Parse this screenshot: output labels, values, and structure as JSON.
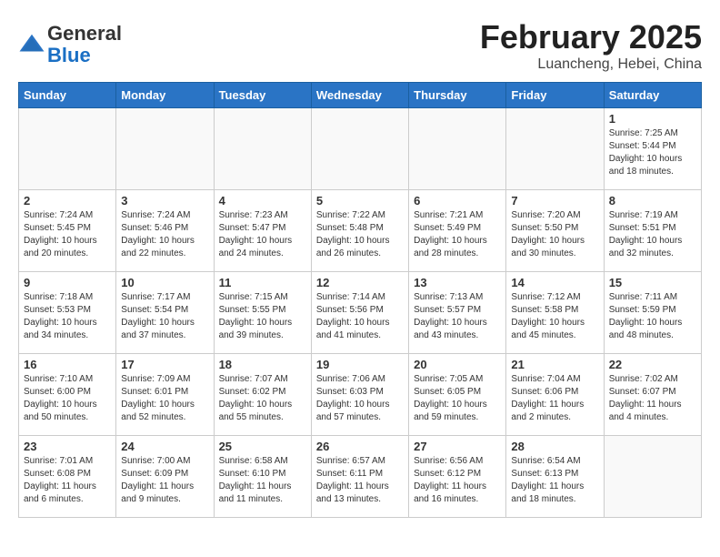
{
  "header": {
    "logo_general": "General",
    "logo_blue": "Blue",
    "month_title": "February 2025",
    "location": "Luancheng, Hebei, China"
  },
  "days_of_week": [
    "Sunday",
    "Monday",
    "Tuesday",
    "Wednesday",
    "Thursday",
    "Friday",
    "Saturday"
  ],
  "weeks": [
    [
      {
        "day": "",
        "info": ""
      },
      {
        "day": "",
        "info": ""
      },
      {
        "day": "",
        "info": ""
      },
      {
        "day": "",
        "info": ""
      },
      {
        "day": "",
        "info": ""
      },
      {
        "day": "",
        "info": ""
      },
      {
        "day": "1",
        "info": "Sunrise: 7:25 AM\nSunset: 5:44 PM\nDaylight: 10 hours\nand 18 minutes."
      }
    ],
    [
      {
        "day": "2",
        "info": "Sunrise: 7:24 AM\nSunset: 5:45 PM\nDaylight: 10 hours\nand 20 minutes."
      },
      {
        "day": "3",
        "info": "Sunrise: 7:24 AM\nSunset: 5:46 PM\nDaylight: 10 hours\nand 22 minutes."
      },
      {
        "day": "4",
        "info": "Sunrise: 7:23 AM\nSunset: 5:47 PM\nDaylight: 10 hours\nand 24 minutes."
      },
      {
        "day": "5",
        "info": "Sunrise: 7:22 AM\nSunset: 5:48 PM\nDaylight: 10 hours\nand 26 minutes."
      },
      {
        "day": "6",
        "info": "Sunrise: 7:21 AM\nSunset: 5:49 PM\nDaylight: 10 hours\nand 28 minutes."
      },
      {
        "day": "7",
        "info": "Sunrise: 7:20 AM\nSunset: 5:50 PM\nDaylight: 10 hours\nand 30 minutes."
      },
      {
        "day": "8",
        "info": "Sunrise: 7:19 AM\nSunset: 5:51 PM\nDaylight: 10 hours\nand 32 minutes."
      }
    ],
    [
      {
        "day": "9",
        "info": "Sunrise: 7:18 AM\nSunset: 5:53 PM\nDaylight: 10 hours\nand 34 minutes."
      },
      {
        "day": "10",
        "info": "Sunrise: 7:17 AM\nSunset: 5:54 PM\nDaylight: 10 hours\nand 37 minutes."
      },
      {
        "day": "11",
        "info": "Sunrise: 7:15 AM\nSunset: 5:55 PM\nDaylight: 10 hours\nand 39 minutes."
      },
      {
        "day": "12",
        "info": "Sunrise: 7:14 AM\nSunset: 5:56 PM\nDaylight: 10 hours\nand 41 minutes."
      },
      {
        "day": "13",
        "info": "Sunrise: 7:13 AM\nSunset: 5:57 PM\nDaylight: 10 hours\nand 43 minutes."
      },
      {
        "day": "14",
        "info": "Sunrise: 7:12 AM\nSunset: 5:58 PM\nDaylight: 10 hours\nand 45 minutes."
      },
      {
        "day": "15",
        "info": "Sunrise: 7:11 AM\nSunset: 5:59 PM\nDaylight: 10 hours\nand 48 minutes."
      }
    ],
    [
      {
        "day": "16",
        "info": "Sunrise: 7:10 AM\nSunset: 6:00 PM\nDaylight: 10 hours\nand 50 minutes."
      },
      {
        "day": "17",
        "info": "Sunrise: 7:09 AM\nSunset: 6:01 PM\nDaylight: 10 hours\nand 52 minutes."
      },
      {
        "day": "18",
        "info": "Sunrise: 7:07 AM\nSunset: 6:02 PM\nDaylight: 10 hours\nand 55 minutes."
      },
      {
        "day": "19",
        "info": "Sunrise: 7:06 AM\nSunset: 6:03 PM\nDaylight: 10 hours\nand 57 minutes."
      },
      {
        "day": "20",
        "info": "Sunrise: 7:05 AM\nSunset: 6:05 PM\nDaylight: 10 hours\nand 59 minutes."
      },
      {
        "day": "21",
        "info": "Sunrise: 7:04 AM\nSunset: 6:06 PM\nDaylight: 11 hours\nand 2 minutes."
      },
      {
        "day": "22",
        "info": "Sunrise: 7:02 AM\nSunset: 6:07 PM\nDaylight: 11 hours\nand 4 minutes."
      }
    ],
    [
      {
        "day": "23",
        "info": "Sunrise: 7:01 AM\nSunset: 6:08 PM\nDaylight: 11 hours\nand 6 minutes."
      },
      {
        "day": "24",
        "info": "Sunrise: 7:00 AM\nSunset: 6:09 PM\nDaylight: 11 hours\nand 9 minutes."
      },
      {
        "day": "25",
        "info": "Sunrise: 6:58 AM\nSunset: 6:10 PM\nDaylight: 11 hours\nand 11 minutes."
      },
      {
        "day": "26",
        "info": "Sunrise: 6:57 AM\nSunset: 6:11 PM\nDaylight: 11 hours\nand 13 minutes."
      },
      {
        "day": "27",
        "info": "Sunrise: 6:56 AM\nSunset: 6:12 PM\nDaylight: 11 hours\nand 16 minutes."
      },
      {
        "day": "28",
        "info": "Sunrise: 6:54 AM\nSunset: 6:13 PM\nDaylight: 11 hours\nand 18 minutes."
      },
      {
        "day": "",
        "info": ""
      }
    ]
  ]
}
